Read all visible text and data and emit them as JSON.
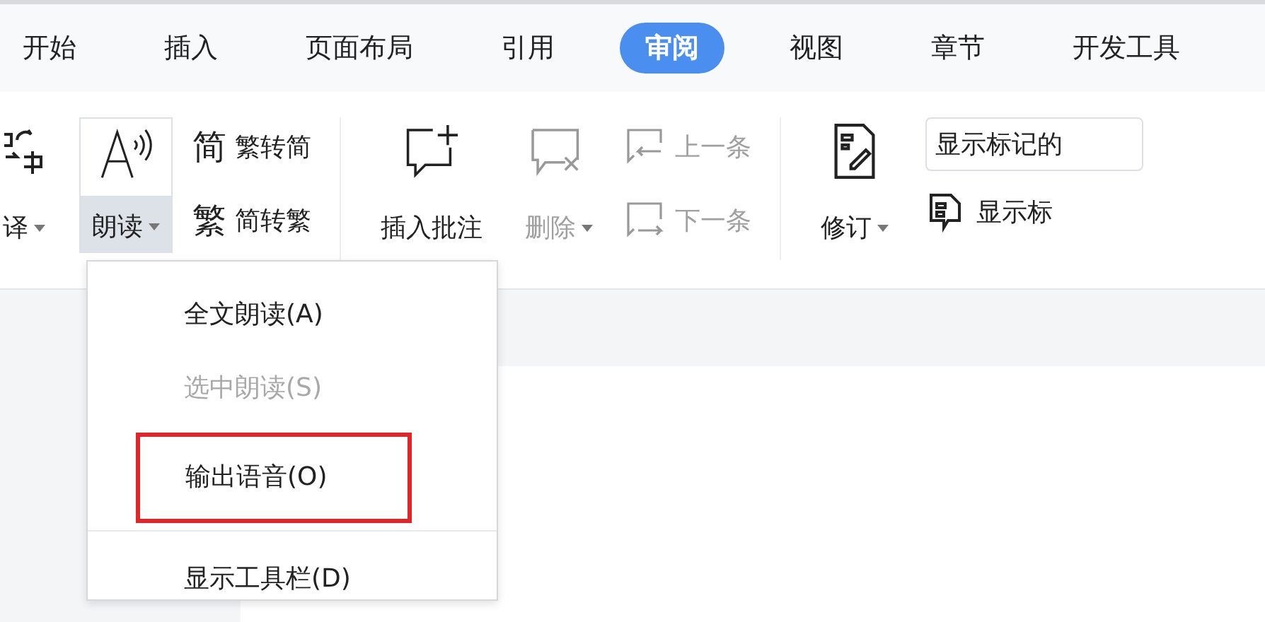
{
  "tabs": [
    {
      "label": "开始",
      "selected": false
    },
    {
      "label": "插入",
      "selected": false
    },
    {
      "label": "页面布局",
      "selected": false
    },
    {
      "label": "引用",
      "selected": false
    },
    {
      "label": "审阅",
      "selected": true
    },
    {
      "label": "视图",
      "selected": false
    },
    {
      "label": "章节",
      "selected": false
    },
    {
      "label": "开发工具",
      "selected": false
    }
  ],
  "ribbon": {
    "sections": [
      [
        {
          "kind": "translate",
          "label": "译",
          "dropdown": true,
          "pressed": false,
          "disabled": false
        },
        {
          "kind": "read-aloud",
          "label": "朗读",
          "dropdown": true,
          "pressed": true,
          "disabled": false
        },
        {
          "kind": "convert",
          "rows": [
            {
              "glyph": "简",
              "label": "繁转简"
            },
            {
              "glyph": "繁",
              "label": "简转繁"
            }
          ]
        }
      ],
      [
        {
          "kind": "comment-insert",
          "label": "插入批注",
          "pressed": false,
          "disabled": false
        },
        {
          "kind": "comment-delete",
          "label": "删除",
          "dropdown": true,
          "pressed": false,
          "disabled": true
        },
        {
          "kind": "comment-nav",
          "rows": [
            {
              "label": "上一条",
              "disabled": true
            },
            {
              "label": "下一条",
              "disabled": true
            }
          ]
        }
      ],
      [
        {
          "kind": "track",
          "label": "修订",
          "dropdown": true,
          "pressed": false,
          "disabled": false
        },
        {
          "kind": "markup",
          "field_value": "显示标记的",
          "button_label": "显示标"
        }
      ]
    ]
  },
  "menu": {
    "items": [
      {
        "label": "全文朗读(A)",
        "disabled": false,
        "highlighted": false
      },
      {
        "label": "选中朗读(S)",
        "disabled": true,
        "highlighted": false
      },
      {
        "label": "输出语音(O)",
        "disabled": false,
        "highlighted": true
      },
      {
        "kind": "separator"
      },
      {
        "label": "显示工具栏(D)",
        "disabled": false,
        "highlighted": false
      }
    ]
  }
}
